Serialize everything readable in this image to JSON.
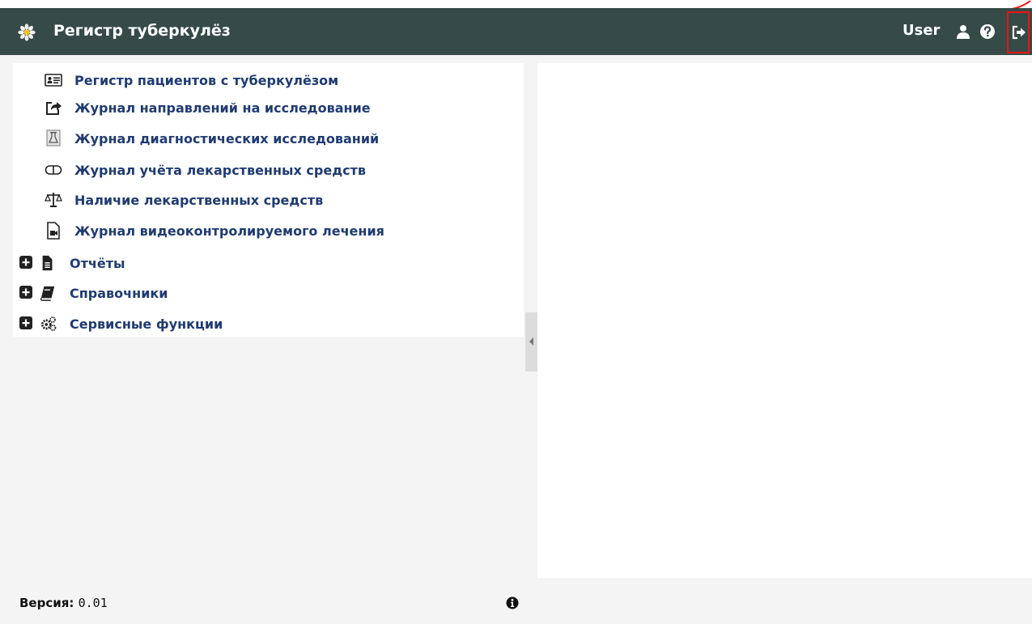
{
  "header": {
    "title": "Регистр туберкулёз",
    "user": "User",
    "logo_icon": "flower-icon",
    "user_icon": "user-icon",
    "help_icon": "help-icon",
    "logout_icon": "logout-icon",
    "background_color": "#364a47",
    "highlight_color": "#ee1111"
  },
  "menu": {
    "link_color": "#1f3b73",
    "items": [
      {
        "label": "Регистр пациентов с туберкулёзом",
        "icon": "id-card-icon"
      },
      {
        "label": "Журнал направлений на исследование",
        "icon": "share-icon"
      },
      {
        "label": "Журнал диагностических исследований",
        "icon": "flask-icon"
      },
      {
        "label": "Журнал учёта лекарственных средств",
        "icon": "pills-icon"
      },
      {
        "label": "Наличие лекарственных средств",
        "icon": "scales-icon"
      },
      {
        "label": "Журнал видеоконтролируемого лечения",
        "icon": "video-file-icon"
      }
    ],
    "groups": [
      {
        "label": "Отчёты",
        "icon": "document-icon"
      },
      {
        "label": "Справочники",
        "icon": "book-icon"
      },
      {
        "label": "Сервисные функции",
        "icon": "gears-icon"
      }
    ]
  },
  "footer": {
    "version_label": "Версия:",
    "version_value": "0.01",
    "info_icon": "info-icon"
  }
}
